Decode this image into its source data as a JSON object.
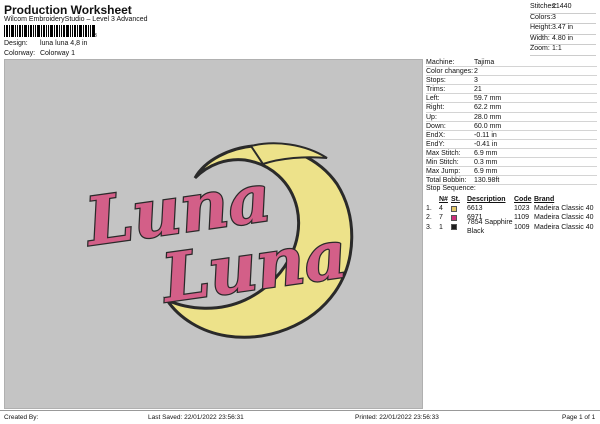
{
  "header": {
    "title": "Production Worksheet",
    "subtitle": "Wilcom EmbroideryStudio – Level 3 Advanced",
    "barcode_number": "3"
  },
  "meta": {
    "design_label": "Design:",
    "design_value": "luna luna 4,8 in",
    "colorway_label": "Colorway:",
    "colorway_value": "Colorway 1"
  },
  "summary": [
    {
      "label": "Stitches:",
      "value": "21440"
    },
    {
      "label": "Colors:",
      "value": "3"
    },
    {
      "label": "Height:",
      "value": "3.47 in"
    },
    {
      "label": "Width:",
      "value": "4.80 in"
    },
    {
      "label": "Zoom:",
      "value": "1:1"
    }
  ],
  "info": [
    {
      "label": "Machine:",
      "value": "Tajima"
    },
    {
      "label": "Color changes:",
      "value": "2"
    },
    {
      "label": "Stops:",
      "value": "3"
    },
    {
      "label": "Trims:",
      "value": "21"
    },
    {
      "label": "Left:",
      "value": "59.7 mm"
    },
    {
      "label": "Right:",
      "value": "62.2 mm"
    },
    {
      "label": "Up:",
      "value": "28.0 mm"
    },
    {
      "label": "Down:",
      "value": "60.0 mm"
    },
    {
      "label": "EndX:",
      "value": "-0.11 in"
    },
    {
      "label": "EndY:",
      "value": "-0.41 in"
    },
    {
      "label": "Max Stitch:",
      "value": "6.9 mm"
    },
    {
      "label": "Min Stitch:",
      "value": "0.3 mm"
    },
    {
      "label": "Max Jump:",
      "value": "6.9 mm"
    },
    {
      "label": "Total Bobbin:",
      "value": "130.98ft"
    }
  ],
  "stop_sequence": {
    "title": "Stop Sequence:",
    "headers": {
      "n": "N#",
      "st": "St.",
      "desc": "Description",
      "code": "Code",
      "brand": "Brand"
    },
    "rows": [
      {
        "stop": "1.",
        "n": "4",
        "color": "#e3c868",
        "desc": "6613",
        "code": "1023",
        "brand": "Madeira Classic 40"
      },
      {
        "stop": "2.",
        "n": "7",
        "color": "#cc2f7a",
        "desc": "6971",
        "code": "1109",
        "brand": "Madeira Classic 40"
      },
      {
        "stop": "3.",
        "n": "1",
        "color": "#1e1e1e",
        "desc": "7854",
        "desc2": "Sapphire Black",
        "code": "1009",
        "brand": "Madeira Classic 40"
      }
    ]
  },
  "design_text": {
    "line1": "Luna",
    "line2": "Luna"
  },
  "colors": {
    "moon": "#ede28a",
    "moon_shade": "#d9ca5e",
    "lettering": "#d35f88",
    "outline": "#2a2a2a",
    "canvas": "#c4c4c4"
  },
  "footer": {
    "created": "Created By:",
    "saved": "Last Saved: 22/01/2022 23:56:31",
    "printed": "Printed: 22/01/2022 23:56:33",
    "page": "Page 1 of 1"
  }
}
